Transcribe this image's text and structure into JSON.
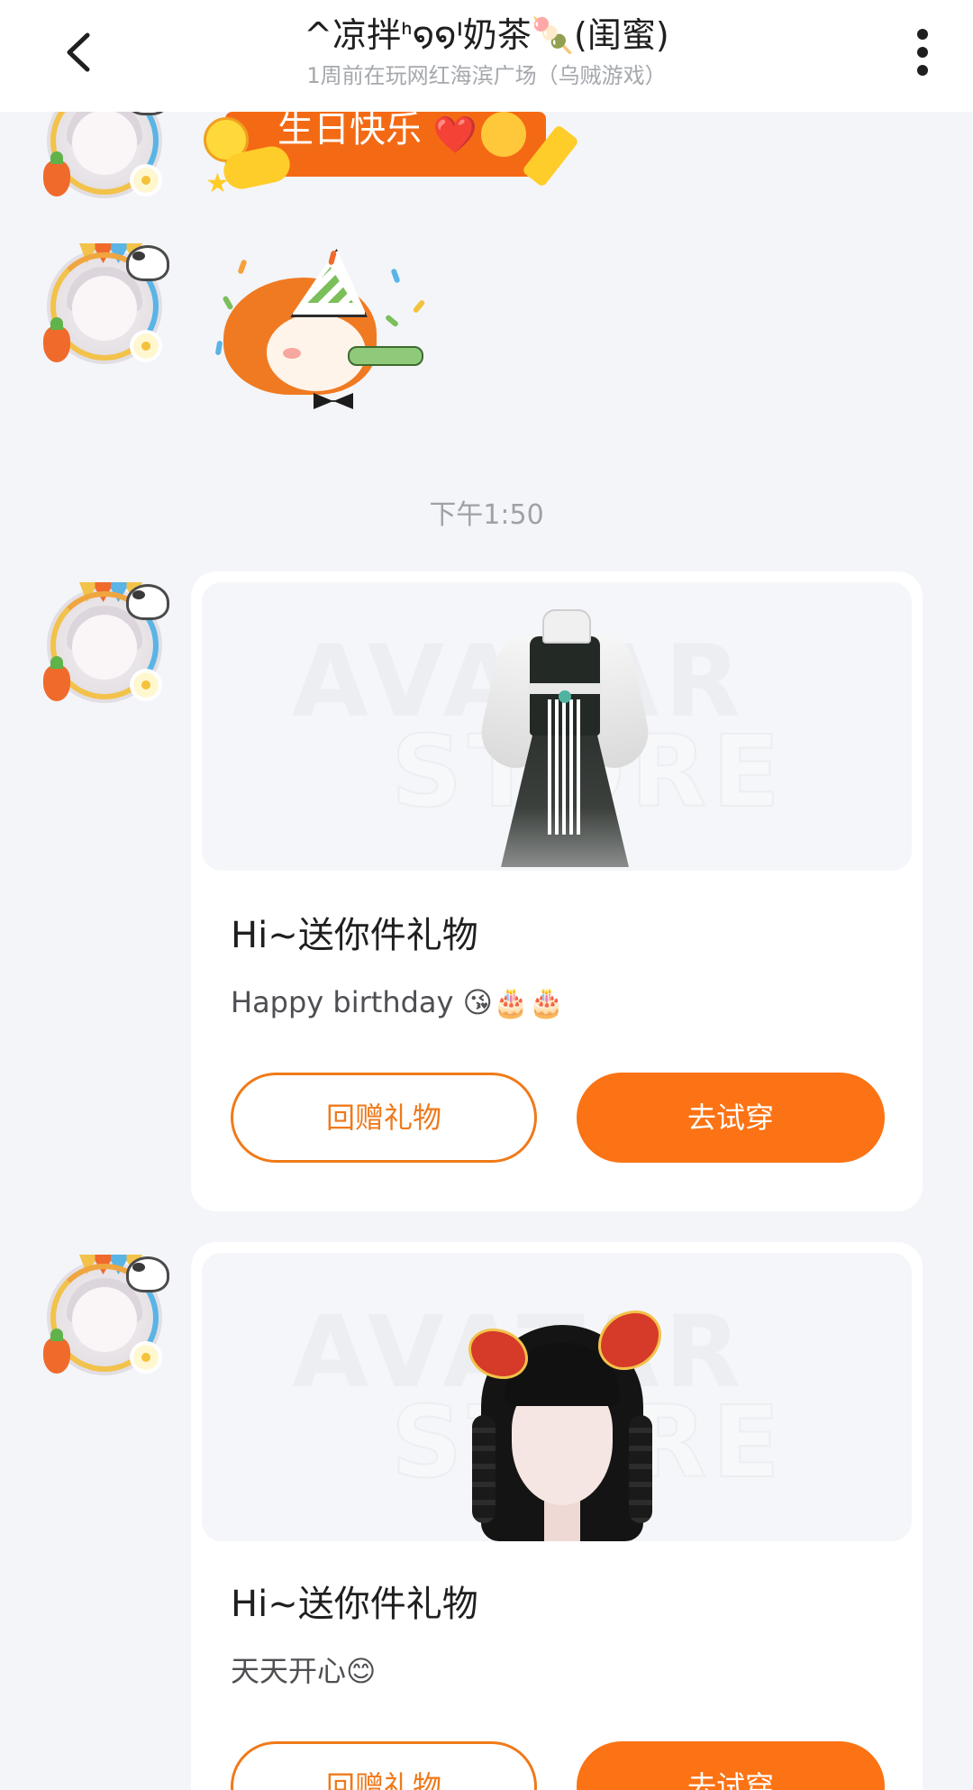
{
  "header": {
    "title": "^凉拌ᑋ໑໑ᑊ奶茶🍡(闺蜜)",
    "subtitle": "1周前在玩网红海滨广场（乌贼游戏）",
    "back_icon": "chevron-left-icon",
    "more_icon": "vertical-dots-icon"
  },
  "messages": {
    "sticker_birthday": {
      "text": "生日快乐",
      "emoji": "❤️"
    },
    "time_divider": "下午1:50",
    "gift_cards": [
      {
        "title": "Hi~送你件礼物",
        "message": "Happy birthday 😘🎂🎂",
        "return_gift_label": "回赠礼物",
        "try_on_label": "去试穿",
        "item": "dress"
      },
      {
        "title": "Hi~送你件礼物",
        "message": "天天开心😊",
        "return_gift_label": "回赠礼物",
        "try_on_label": "去试穿",
        "item": "hairstyle"
      }
    ]
  },
  "colors": {
    "accent": "#fb7314",
    "background": "#f3f5f9",
    "card": "#ffffff",
    "muted_text": "#9ea1a6"
  }
}
